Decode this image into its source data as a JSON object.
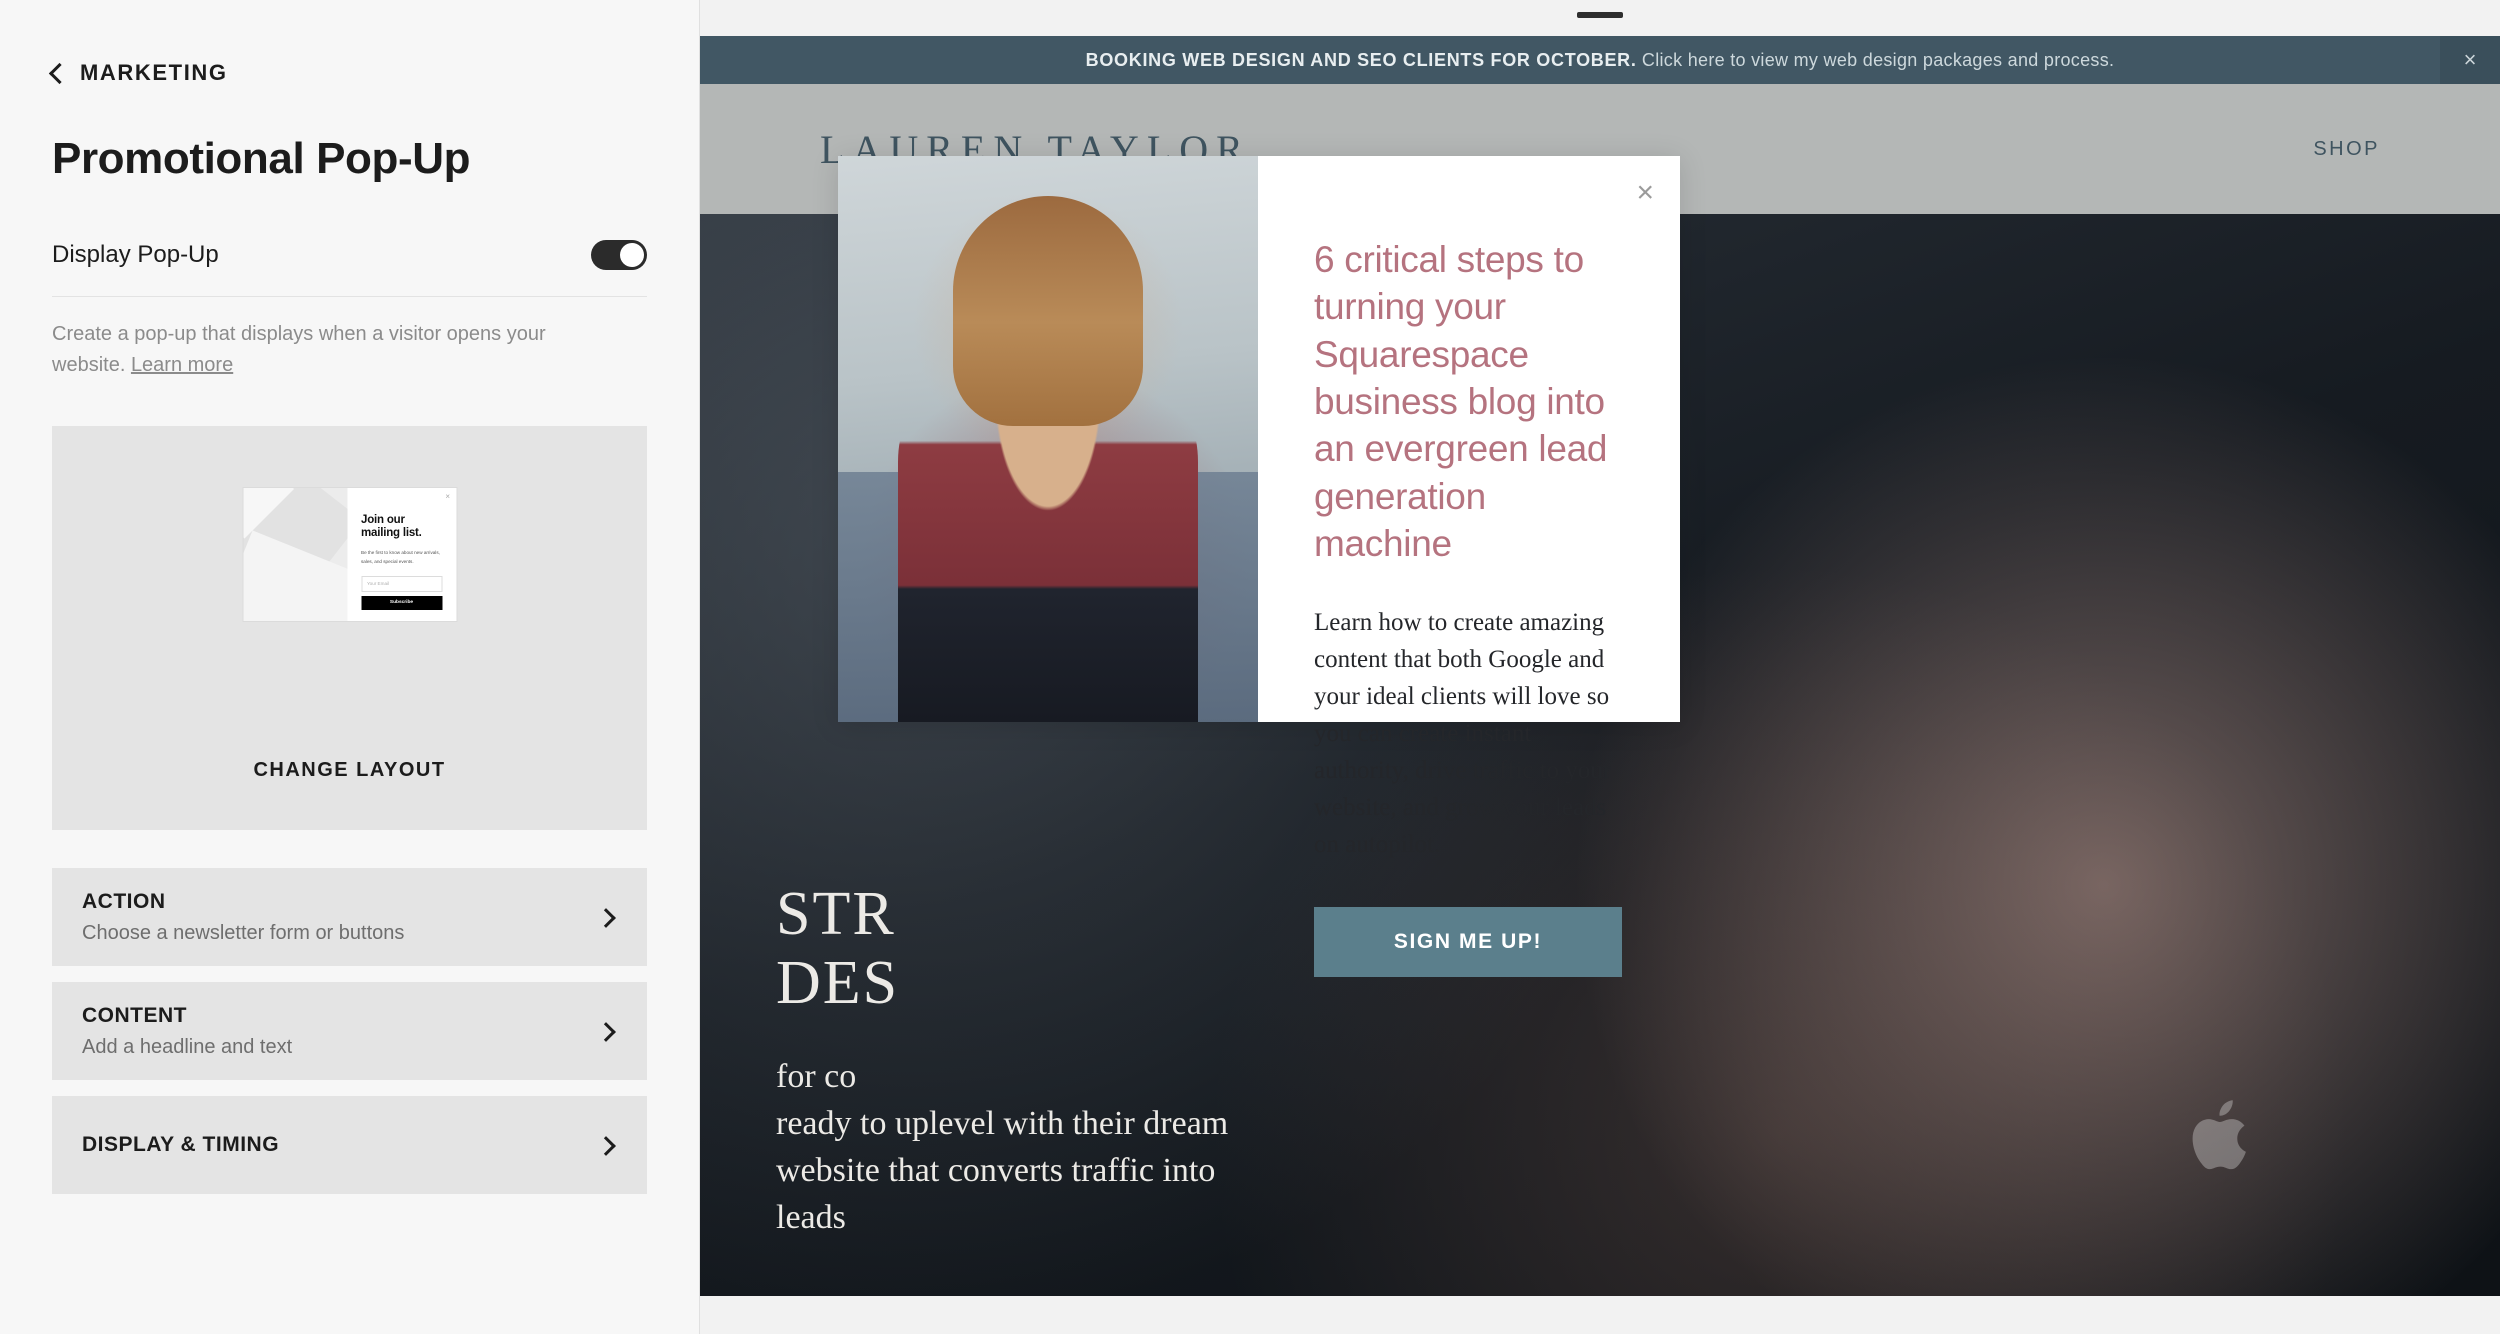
{
  "sidebar": {
    "back_label": "MARKETING",
    "page_title": "Promotional Pop-Up",
    "toggle": {
      "label": "Display Pop-Up",
      "state": "on"
    },
    "helper_text": "Create a pop-up that displays when a visitor opens your website.",
    "helper_link": "Learn more",
    "layout_preview": {
      "close_glyph": "×",
      "headline": "Join our mailing list.",
      "subtext": "Be the first to know about new arrivals, sales, and special events.",
      "input_placeholder": "Your Email",
      "button_label": "Subscribe"
    },
    "change_layout_label": "CHANGE LAYOUT",
    "sections": [
      {
        "title": "ACTION",
        "desc": "Choose a newsletter form or buttons"
      },
      {
        "title": "CONTENT",
        "desc": "Add a headline and text"
      },
      {
        "title": "DISPLAY & TIMING",
        "desc": ""
      }
    ]
  },
  "preview": {
    "announcement": {
      "bold": "BOOKING WEB DESIGN AND SEO CLIENTS FOR OCTOBER.",
      "rest": " Click here to view my web design packages and process.",
      "close_glyph": "×",
      "bg": "#415764"
    },
    "site_header": {
      "logo": "LAUREN TAYLOR",
      "nav": [
        "SHOP"
      ]
    },
    "hero": {
      "title_line1": "STR",
      "title_line2": "DES",
      "sub_line1": "for co",
      "sub_line2": "ready to uplevel with their dream",
      "sub_line3": "website that converts traffic into",
      "sub_line4": "leads"
    },
    "popup": {
      "close_glyph": "×",
      "headline": "6 critical steps to turning your Squarespace business blog into an evergreen lead generation machine",
      "headline_color": "#b5737f",
      "paragraph": "Learn how to create amazing content that both Google and your ideal clients will love so you can create instant authority, drive traffic to your website, and grow your leads on autopilot.",
      "cta_label": "SIGN ME UP!",
      "cta_color": "#5b7f8c"
    }
  }
}
